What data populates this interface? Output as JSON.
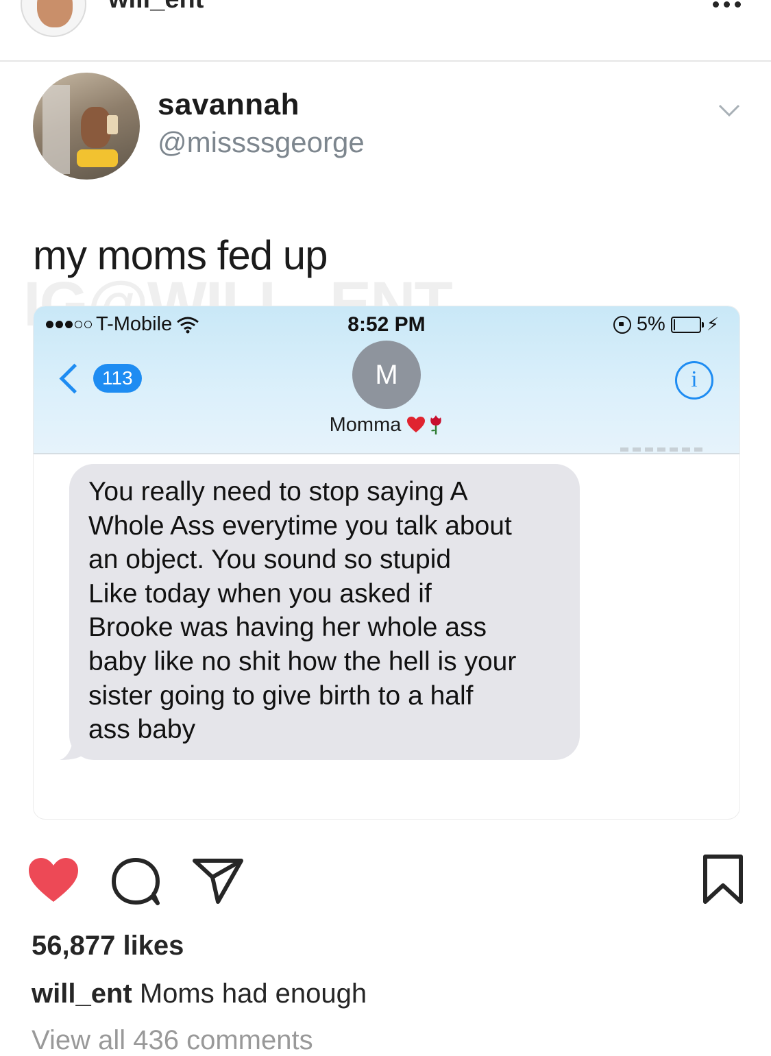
{
  "post_header": {
    "username": "will_ent",
    "more_icon": "ellipsis-icon"
  },
  "tweet": {
    "name": "savannah",
    "handle": "@missssgeorge",
    "text": "my moms fed up",
    "watermark": "IG@WILL_ENT",
    "chevron_icon": "chevron-down-icon"
  },
  "message_screenshot": {
    "status_bar": {
      "carrier": "T-Mobile",
      "time": "8:52 PM",
      "battery_percent": "5%",
      "battery_level": 0.05
    },
    "nav": {
      "back_count": "113",
      "contact_initial": "M",
      "contact_name": "Momma",
      "info_label": "i"
    },
    "bubble_lines": [
      "You really need to stop saying A",
      "Whole Ass everytime you talk about",
      "an object. You sound so stupid",
      "Like today when you asked if",
      "Brooke was having her whole ass",
      "baby like no shit how the hell is your",
      "sister going to give birth to a half",
      "ass baby"
    ]
  },
  "actions": {
    "like_icon": "heart-icon",
    "comment_icon": "comment-icon",
    "share_icon": "paper-plane-icon",
    "save_icon": "bookmark-icon",
    "liked": true
  },
  "likes_text": "56,877 likes",
  "caption": {
    "username": "will_ent",
    "text": "Moms had enough"
  },
  "view_comments": "View all 436 comments",
  "colors": {
    "heart": "#ed4956",
    "ios_blue": "#1e8cf2",
    "bubble": "#e5e5ea",
    "handle_gray": "#7d868e"
  }
}
